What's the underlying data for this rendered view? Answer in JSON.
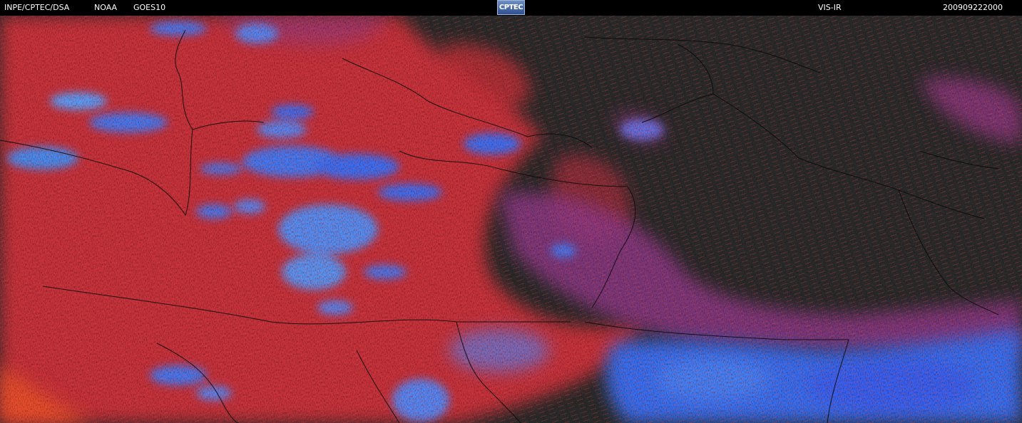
{
  "header": {
    "source": "INPE/CPTEC/DSA",
    "agency": "NOAA",
    "satellite": "GOES10",
    "logo_text": "CPTEC",
    "channel": "VIS-IR",
    "timestamp": "200909222000"
  },
  "colors": {
    "background": "#000000",
    "land_dark": "#2b2b2b",
    "cloud_red": "#c8303a",
    "cloud_magenta": "#9a3a8a",
    "cloud_blue": "#3a6ef0",
    "cloud_cyan": "#5aa0ff",
    "hot_orange": "#e8502a",
    "border_line": "#000000"
  }
}
